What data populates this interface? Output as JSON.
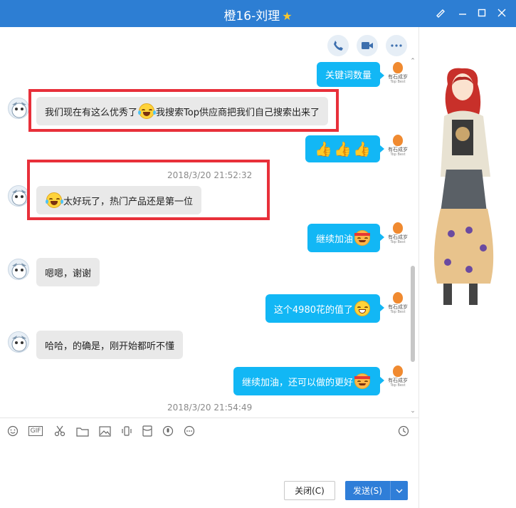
{
  "window": {
    "title": "橙16-刘理"
  },
  "header_tools": [
    "phone-icon",
    "video-call-icon",
    "more-icon"
  ],
  "messages": [
    {
      "side": "out",
      "text": "关键词数量"
    },
    {
      "side": "in",
      "text_before": "我们现在有这么优秀了",
      "text_after": "我搜索Top供应商把我们自己搜索出来了"
    },
    {
      "side": "out",
      "text": ""
    },
    {
      "time": "2018/3/20 21:52:32"
    },
    {
      "side": "in",
      "text": "太好玩了，热门产品还是第一位"
    },
    {
      "side": "out",
      "text": "继续加油"
    },
    {
      "side": "in",
      "text": "嗯嗯，谢谢"
    },
    {
      "side": "out",
      "text": "这个4980花的值了"
    },
    {
      "side": "in",
      "text": "哈哈，的确是，刚开始都听不懂"
    },
    {
      "side": "out",
      "text": "继续加油，还可以做的更好"
    },
    {
      "time": "2018/3/20 21:54:49"
    }
  ],
  "company_logo": {
    "name": "有石成岁",
    "sub": "Top Best"
  },
  "toolbar": [
    "emoji-icon",
    "gif-icon",
    "scissors-icon",
    "folder-icon",
    "image-icon",
    "shake-icon",
    "red-packet-icon",
    "voice-icon",
    "more-icon",
    "history-icon"
  ],
  "gif_label": "GIF",
  "buttons": {
    "close": "关闭(C)",
    "send": "发送(S)"
  },
  "colors": {
    "titlebar": "#2d7ed3",
    "bubble_out": "#12b7f5",
    "bubble_in": "#e9e9e9",
    "highlight": "#e8303a"
  }
}
